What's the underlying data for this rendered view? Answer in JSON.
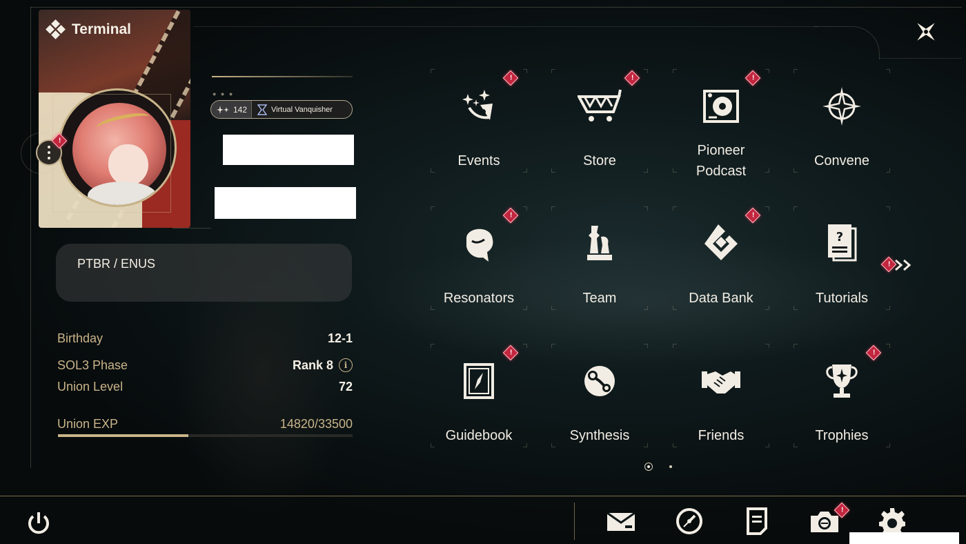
{
  "header": {
    "title": "Terminal",
    "icons": {
      "title": "diamond-cluster-icon",
      "close": "close-star-icon"
    }
  },
  "profile": {
    "level": "142",
    "title_badge": "Virtual Vanquisher",
    "signature": "PTBR / ENUS",
    "stats": {
      "birthday_label": "Birthday",
      "birthday_value": "12-1",
      "sol3_label": "SOL3 Phase",
      "sol3_value": "Rank 8",
      "union_level_label": "Union Level",
      "union_level_value": "72",
      "union_exp_label": "Union EXP",
      "union_exp_value": "14820/33500",
      "union_exp_progress": 0.442
    }
  },
  "menu": {
    "items": [
      {
        "label": "Events",
        "icon": "events-sparkle-icon",
        "alert": true
      },
      {
        "label": "Store",
        "icon": "shopping-cart-icon",
        "alert": true
      },
      {
        "label": "Pioneer Podcast",
        "icon": "record-player-icon",
        "alert": true
      },
      {
        "label": "Convene",
        "icon": "convene-star-icon",
        "alert": false
      },
      {
        "label": "Resonators",
        "icon": "resonator-head-icon",
        "alert": true
      },
      {
        "label": "Team",
        "icon": "chess-pieces-icon",
        "alert": false
      },
      {
        "label": "Data Bank",
        "icon": "data-bank-icon",
        "alert": true
      },
      {
        "label": "Tutorials",
        "icon": "tutorial-document-icon",
        "alert": false
      },
      {
        "label": "Guidebook",
        "icon": "guidebook-compass-icon",
        "alert": true
      },
      {
        "label": "Synthesis",
        "icon": "synthesis-orb-icon",
        "alert": false
      },
      {
        "label": "Friends",
        "icon": "handshake-icon",
        "alert": false
      },
      {
        "label": "Trophies",
        "icon": "trophy-icon",
        "alert": true
      }
    ],
    "page_count": 2,
    "current_page": 1
  },
  "bottom_bar": {
    "icons": [
      "power-icon",
      "mail-icon",
      "clock-icon",
      "notes-icon",
      "camera-icon",
      "settings-gear-icon"
    ],
    "camera_alert": true
  },
  "colors": {
    "accent_gold": "#c9b48a",
    "alert_red": "#c3263f",
    "text_light": "#f2ede4"
  }
}
